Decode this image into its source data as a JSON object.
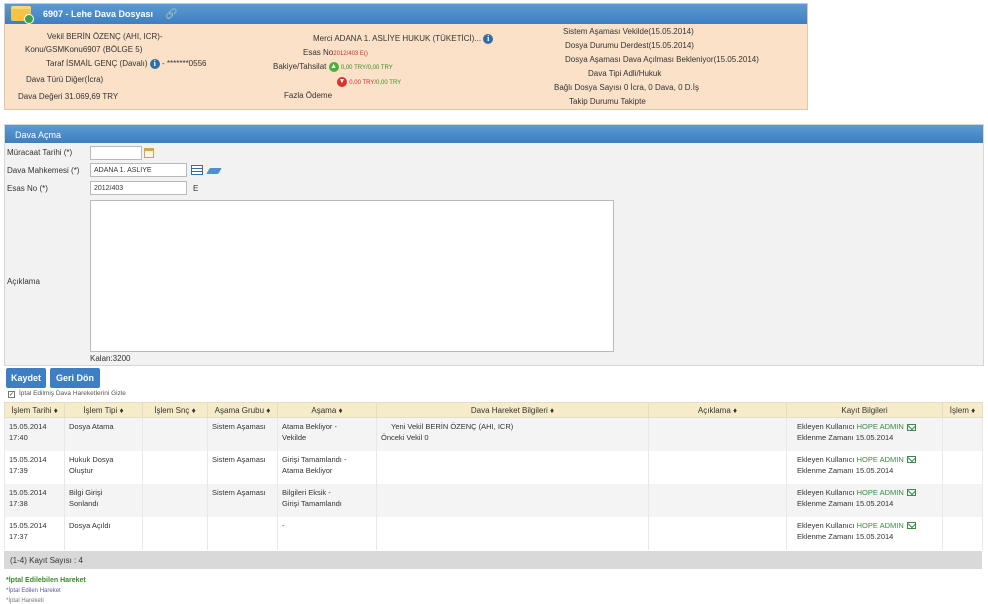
{
  "case": {
    "title": "6907 - Lehe Dava Dosyası",
    "vekil_label": "Vekil",
    "vekil_value": "BERİN ÖZENÇ (AHI, ICR)-",
    "konu_label": "Konu/GSM",
    "konu_value": "Konu6907 (BÖLGE 5)",
    "taraf_label": "Taraf",
    "taraf_value": "İSMAİL GENÇ (Davalı)",
    "taraf_phone": "- *******0556",
    "dava_turu_label": "Dava Türü",
    "dava_turu_value": "Diğer(İcra)",
    "dava_degeri_label": "Dava Değeri",
    "dava_degeri_value": "31.069,69 TRY",
    "merci_label": "Merci",
    "merci_value": "ADANA 1. ASLİYE HUKUK (TÜKETİCİ)...",
    "esas_no_label": "Esas No",
    "esas_no_value": "2012/403 E()",
    "bakiye_label": "Bakiye/Tahsilat",
    "bakiye_a": "0,00 TRY",
    "bakiye_b": "0,00 TRY",
    "bakiye_c": "0,00 TRY",
    "bakiye_d": "0,00 TRY",
    "fazla_odeme_label": "Fazla Ödeme",
    "sistem_asamasi_label": "Sistem Aşaması",
    "sistem_asamasi_value": "Vekilde(15.05.2014)",
    "dosya_durumu_label": "Dosya Durumu",
    "dosya_durumu_value": "Derdest(15.05.2014)",
    "dosya_asamasi_label": "Dosya Aşaması",
    "dosya_asamasi_value": "Dava Açılması Bekleniyor(15.05.2014)",
    "dava_tipi_label": "Dava Tipi",
    "dava_tipi_value": "Adli/Hukuk",
    "bagli_dosya_label": "Bağlı Dosya Sayısı",
    "bagli_dosya_value": "0 İcra, 0 Dava, 0 D.İş",
    "takip_durumu_label": "Takip Durumu",
    "takip_durumu_value": "Takipte"
  },
  "form": {
    "title": "Dava Açma",
    "muracaat_label": "Müracaat Tarihi (*)",
    "muracaat_value": "",
    "mahkeme_label": "Dava Mahkemesi (*)",
    "mahkeme_value": "ADANA 1. ASLİYE",
    "esas_label": "Esas No (*)",
    "esas_value": "2012/403",
    "esas_suffix": "E",
    "aciklama_label": "Açıklama",
    "kalan": "Kalan:3200"
  },
  "buttons": {
    "save": "Kaydet",
    "back": "Geri Dön"
  },
  "hide_cancelled_label": "İptal Edilmiş Dava Hareketlerini Gizle",
  "table": {
    "headers": [
      "İşlem Tarihi",
      "İşlem Tipi",
      "İşlem Snç",
      "Aşama Grubu",
      "Aşama",
      "Dava Hareket Bilgileri",
      "Açıklama",
      "Kayıt Bilgileri",
      "İşlem"
    ],
    "rows": [
      {
        "date": "15.05.2014",
        "time": "17:40",
        "type1": "Dosya Atama",
        "type2": "",
        "snc": "",
        "group": "Sistem Aşaması",
        "stage1": "Atama Bekliyor -",
        "stage2": "Vekilde",
        "info1": "Yeni Vekil BERİN ÖZENÇ (AHI, ICR)",
        "info2": "Önceki Vekil 0",
        "note": "",
        "added_by_label": "Ekleyen Kullanıcı",
        "added_by": "HOPE ADMIN",
        "added_at_label": "Eklenme Zamanı",
        "added_at": "15.05.2014"
      },
      {
        "date": "15.05.2014",
        "time": "17:39",
        "type1": "Hukuk Dosya",
        "type2": "Oluştur",
        "snc": "",
        "group": "Sistem Aşaması",
        "stage1": "Girişi Tamamlandı -",
        "stage2": "Atama Bekliyor",
        "info1": "",
        "info2": "",
        "note": "",
        "added_by_label": "Ekleyen Kullanıcı",
        "added_by": "HOPE ADMIN",
        "added_at_label": "Eklenme Zamanı",
        "added_at": "15.05.2014"
      },
      {
        "date": "15.05.2014",
        "time": "17:38",
        "type1": "Bilgi Girişi",
        "type2": "Sonlandı",
        "snc": "",
        "group": "Sistem Aşaması",
        "stage1": "Bilgileri Eksik -",
        "stage2": "Girişi Tamamlandı",
        "info1": "",
        "info2": "",
        "note": "",
        "added_by_label": "Ekleyen Kullanıcı",
        "added_by": "HOPE ADMIN",
        "added_at_label": "Eklenme Zamanı",
        "added_at": "15.05.2014"
      },
      {
        "date": "15.05.2014",
        "time": "17:37",
        "type1": "Dosya Açıldı",
        "type2": "",
        "snc": "",
        "group": "",
        "stage1": "-",
        "stage2": "",
        "info1": "",
        "info2": "",
        "note": "",
        "added_by_label": "Ekleyen Kullanıcı",
        "added_by": "HOPE ADMIN",
        "added_at_label": "Eklenme Zamanı",
        "added_at": "15.05.2014"
      }
    ],
    "record_count": "(1-4) Kayıt Sayısı : 4"
  },
  "legend": {
    "cancellable": "*İptal Edilebilen Hareket",
    "cancelled": "*İptal Edilen Hareket",
    "cancel_move": "*İptal Hareketi"
  },
  "colors": {
    "header_blue": "#4a8ac9",
    "panel_bg": "#fbe1c8",
    "table_header_bg": "#f6ecca",
    "admin_green": "#3b8a4a"
  }
}
